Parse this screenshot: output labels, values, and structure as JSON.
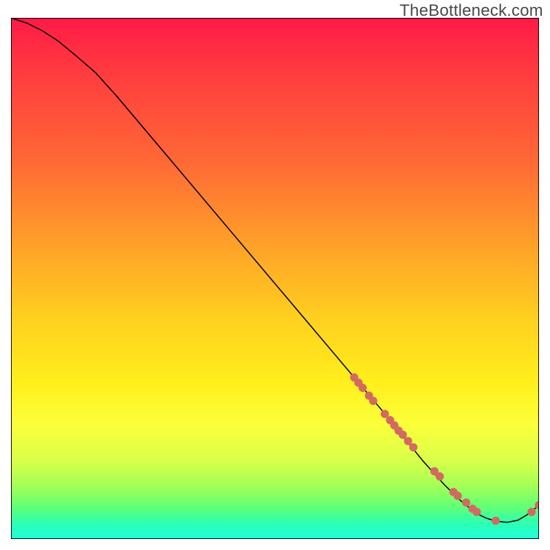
{
  "watermark": "TheBottleneck.com",
  "chart_data": {
    "type": "line",
    "title": "",
    "xlabel": "",
    "ylabel": "",
    "xlim": [
      0,
      100
    ],
    "ylim": [
      0,
      100
    ],
    "grid": false,
    "legend": false,
    "background": {
      "type": "vertical-gradient",
      "stops": [
        {
          "pos": 0,
          "color": "#ff1a47"
        },
        {
          "pos": 0.28,
          "color": "#ff6a35"
        },
        {
          "pos": 0.58,
          "color": "#ffd11f"
        },
        {
          "pos": 0.78,
          "color": "#fbff3a"
        },
        {
          "pos": 0.94,
          "color": "#5fff78"
        },
        {
          "pos": 1.0,
          "color": "#1fffd8"
        }
      ]
    },
    "series": [
      {
        "name": "bottleneck-curve",
        "x": [
          0,
          3,
          6,
          9,
          12,
          16,
          20,
          25,
          30,
          35,
          40,
          45,
          50,
          55,
          60,
          65,
          70,
          74,
          78,
          82,
          85,
          88,
          90,
          92,
          94,
          96,
          98,
          100
        ],
        "y": [
          100,
          99,
          97.5,
          95.5,
          93,
          89.5,
          85,
          79,
          73,
          67,
          61,
          55,
          49,
          43,
          37,
          31,
          25,
          20,
          15,
          10.5,
          7.5,
          5,
          4,
          3.4,
          3.2,
          3.6,
          4.8,
          6.5
        ]
      }
    ],
    "points": [
      {
        "name": "marker-cluster",
        "note": "salmon circular markers scattered along the lower-right segment of the curve",
        "x": [
          65,
          65.8,
          66.6,
          67.8,
          68.6,
          70.8,
          71.8,
          72.6,
          73.4,
          74.2,
          75.2,
          76.2,
          80.2,
          81.2,
          83.8,
          84.6,
          86.2,
          87.4,
          88.2,
          91.8,
          98.6,
          100
        ],
        "y": [
          31,
          30,
          29,
          27.5,
          26.5,
          24,
          22.8,
          21.8,
          20.8,
          20,
          18.8,
          17.6,
          13,
          12,
          9,
          8.3,
          7,
          5.8,
          5.2,
          3.5,
          5.2,
          6.5
        ],
        "r": 6
      }
    ]
  }
}
